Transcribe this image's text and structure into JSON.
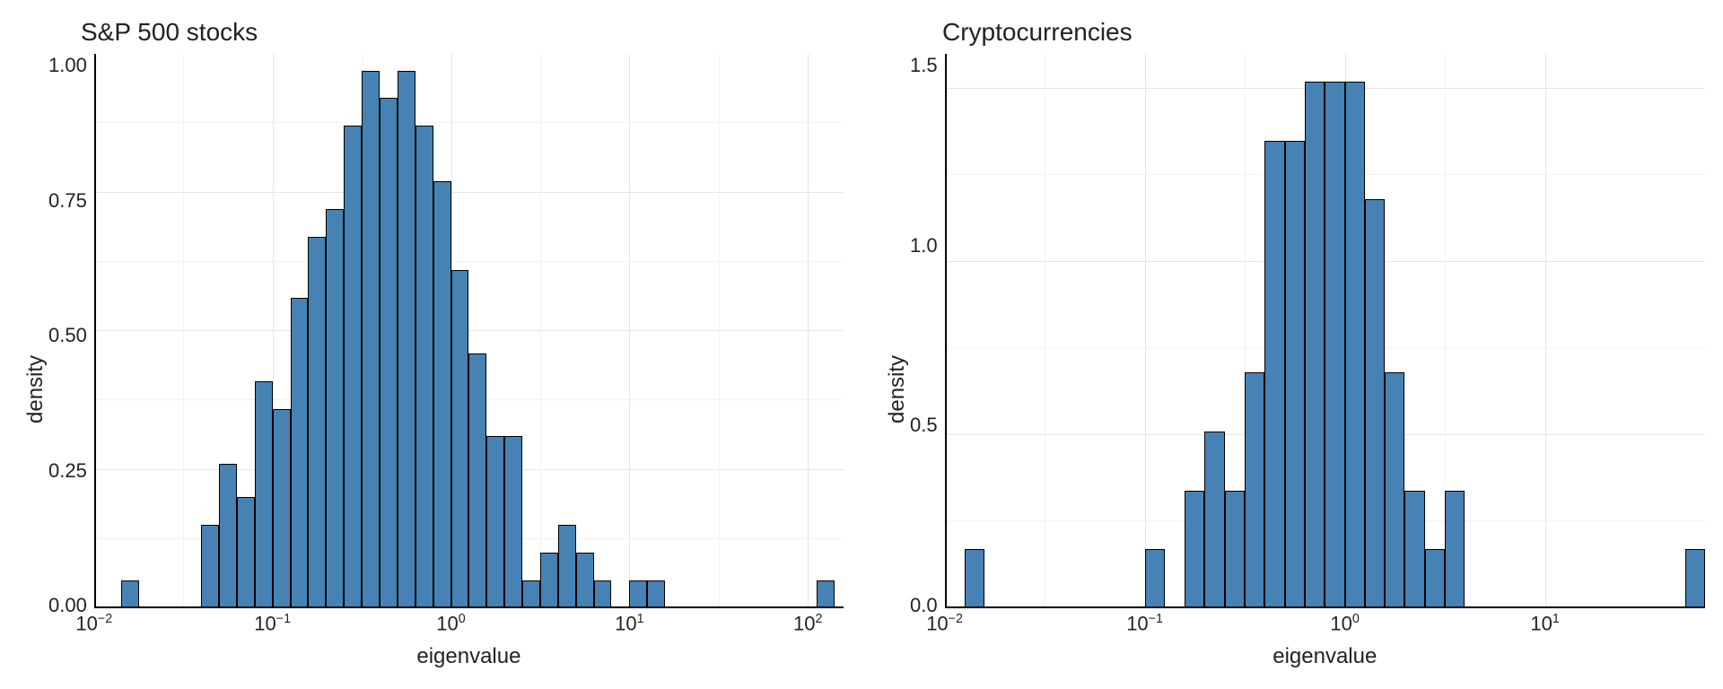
{
  "chart_data": [
    {
      "type": "histogram",
      "title": "S&P 500 stocks",
      "xlabel": "eigenvalue",
      "ylabel": "density",
      "x_scale": "log10",
      "x_range_log": [
        -2.0,
        2.2
      ],
      "y_range": [
        0,
        1.0
      ],
      "y_ticks": [
        0.0,
        0.25,
        0.5,
        0.75,
        1.0
      ],
      "x_tick_powers": [
        -2,
        -1,
        0,
        1,
        2
      ],
      "bin_width_log": 0.1,
      "bins": [
        {
          "x_log": -1.8,
          "density": 0.05
        },
        {
          "x_log": -1.35,
          "density": 0.15
        },
        {
          "x_log": -1.25,
          "density": 0.26
        },
        {
          "x_log": -1.15,
          "density": 0.2
        },
        {
          "x_log": -1.05,
          "density": 0.41
        },
        {
          "x_log": -0.95,
          "density": 0.36
        },
        {
          "x_log": -0.85,
          "density": 0.56
        },
        {
          "x_log": -0.75,
          "density": 0.67
        },
        {
          "x_log": -0.65,
          "density": 0.72
        },
        {
          "x_log": -0.55,
          "density": 0.87
        },
        {
          "x_log": -0.45,
          "density": 0.97
        },
        {
          "x_log": -0.35,
          "density": 0.92
        },
        {
          "x_log": -0.25,
          "density": 0.97
        },
        {
          "x_log": -0.15,
          "density": 0.87
        },
        {
          "x_log": -0.05,
          "density": 0.77
        },
        {
          "x_log": 0.05,
          "density": 0.61
        },
        {
          "x_log": 0.15,
          "density": 0.46
        },
        {
          "x_log": 0.25,
          "density": 0.31
        },
        {
          "x_log": 0.35,
          "density": 0.31
        },
        {
          "x_log": 0.45,
          "density": 0.05
        },
        {
          "x_log": 0.55,
          "density": 0.1
        },
        {
          "x_log": 0.65,
          "density": 0.15
        },
        {
          "x_log": 0.75,
          "density": 0.1
        },
        {
          "x_log": 0.85,
          "density": 0.05
        },
        {
          "x_log": 1.05,
          "density": 0.05
        },
        {
          "x_log": 1.15,
          "density": 0.05
        },
        {
          "x_log": 2.1,
          "density": 0.05
        }
      ]
    },
    {
      "type": "histogram",
      "title": "Cryptocurrencies",
      "xlabel": "eigenvalue",
      "ylabel": "density",
      "x_scale": "log10",
      "x_range_log": [
        -2.0,
        1.8
      ],
      "y_range": [
        0,
        1.6
      ],
      "y_ticks": [
        0.0,
        0.5,
        1.0,
        1.5
      ],
      "x_tick_powers": [
        -2,
        -1,
        0,
        1
      ],
      "bin_width_log": 0.1,
      "bins": [
        {
          "x_log": -1.85,
          "density": 0.17
        },
        {
          "x_log": -0.95,
          "density": 0.17
        },
        {
          "x_log": -0.75,
          "density": 0.34
        },
        {
          "x_log": -0.65,
          "density": 0.51
        },
        {
          "x_log": -0.55,
          "density": 0.34
        },
        {
          "x_log": -0.45,
          "density": 0.68
        },
        {
          "x_log": -0.35,
          "density": 1.35
        },
        {
          "x_log": -0.25,
          "density": 1.35
        },
        {
          "x_log": -0.15,
          "density": 1.52
        },
        {
          "x_log": -0.05,
          "density": 1.52
        },
        {
          "x_log": 0.05,
          "density": 1.52
        },
        {
          "x_log": 0.15,
          "density": 1.18
        },
        {
          "x_log": 0.25,
          "density": 0.68
        },
        {
          "x_log": 0.35,
          "density": 0.34
        },
        {
          "x_log": 0.45,
          "density": 0.17
        },
        {
          "x_log": 0.55,
          "density": 0.34
        },
        {
          "x_log": 1.75,
          "density": 0.17
        }
      ]
    }
  ]
}
